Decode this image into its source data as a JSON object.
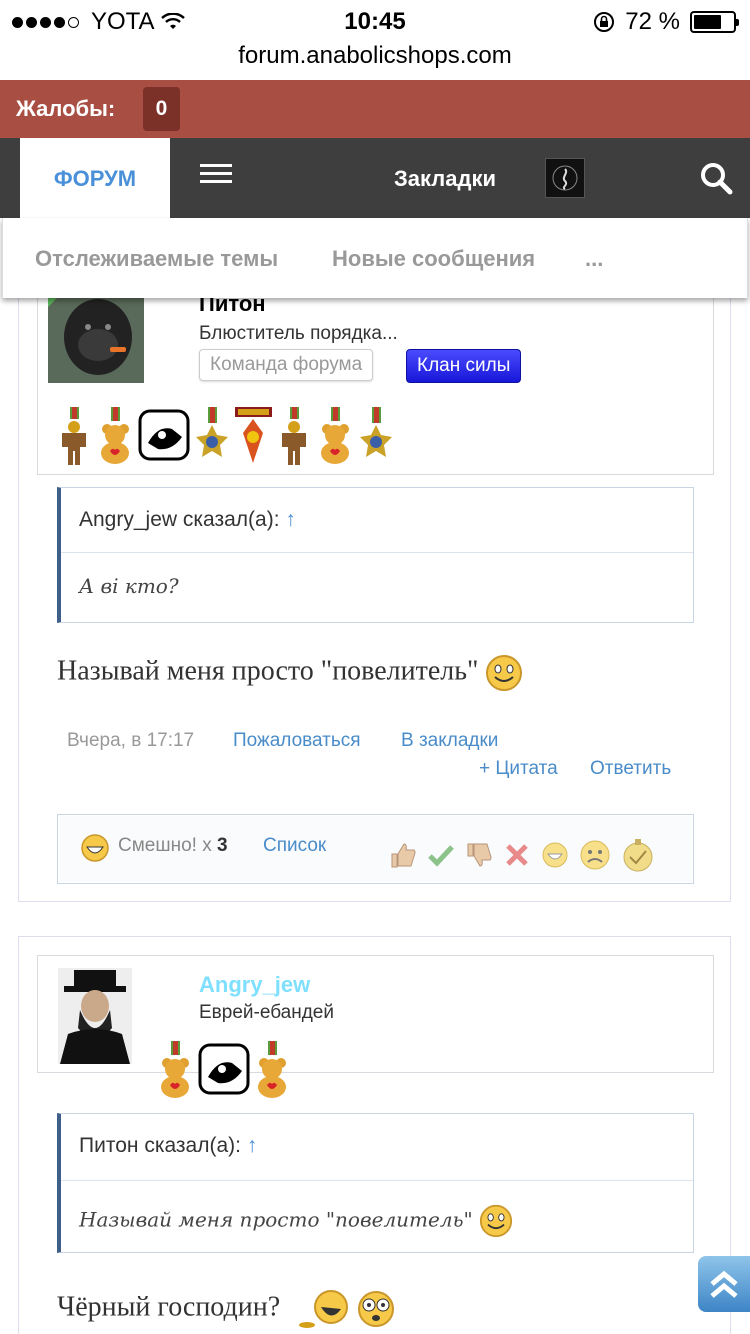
{
  "status_bar": {
    "carrier": "YOTA",
    "time": "10:45",
    "battery": "72 %",
    "battery_level": 0.72,
    "url": "forum.anabolicshops.com"
  },
  "complaints": {
    "label": "Жалобы:",
    "count": "0"
  },
  "nav": {
    "tab_forum": "ФОРУМ",
    "menu_icon": "hamburger-icon",
    "bookmarks": "Закладки",
    "search_icon": "search-icon"
  },
  "subnav": {
    "items": [
      "Отслеживаемые темы",
      "Новые сообщения",
      "..."
    ]
  },
  "posts": [
    {
      "username": "Питон",
      "user_title": "Блюститель порядка...",
      "badges": [
        "Команда форума",
        "Клан силы"
      ],
      "quote": {
        "author_label": "Angry_jew сказал(а):",
        "arrow": "↑",
        "text": "А ві кто?"
      },
      "message": "Называй меня просто \"повелитель\"",
      "time": "Вчера, в 17:17",
      "actions": [
        "Пожаловаться",
        "В закладки",
        "+ Цитата",
        "Ответить"
      ],
      "likes": {
        "label": "Смешно!",
        "times": "x",
        "count": "3",
        "list_label": "Список"
      }
    },
    {
      "username": "Angry_jew",
      "user_title": "Еврей-ебандей",
      "quote": {
        "author_label": "Питон сказал(а):",
        "arrow": "↑",
        "text": "Называй меня просто \"повелитель\""
      },
      "message": "Чёрный господин?"
    }
  ],
  "colors": {
    "complaints_bar": "#a94e43",
    "nav_bar": "#3e3e3e",
    "link": "#4a8cc9",
    "angry_jew_name": "#7fdfff",
    "clan_badge": "#2a2ae8"
  }
}
